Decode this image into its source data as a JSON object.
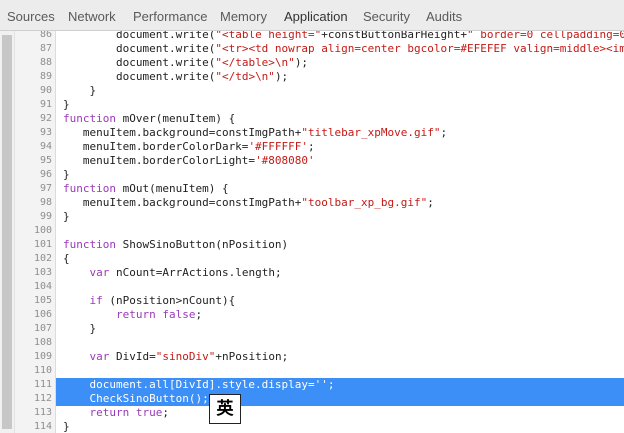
{
  "tabs": [
    {
      "label": "Sources",
      "active": false
    },
    {
      "label": "Network",
      "active": false
    },
    {
      "label": "Performance",
      "active": false
    },
    {
      "label": "Memory",
      "active": false
    },
    {
      "label": "Application",
      "active": true
    },
    {
      "label": "Security",
      "active": false
    },
    {
      "label": "Audits",
      "active": false
    }
  ],
  "colors": {
    "keyword": "#9a3bb8",
    "string": "#c41a16",
    "selection": "#3b8ff6",
    "line_number": "#8e8e8e"
  },
  "code_lines": [
    {
      "n": "86",
      "text": "        document.write(\"<table height=\"+constButtonBarHeight+\" border=0 cellpadding=0"
    },
    {
      "n": "87",
      "text": "        document.write(\"<tr><td nowrap align=center bgcolor=#EFEFEF valign=middle><im"
    },
    {
      "n": "88",
      "text": "        document.write(\"</table>\\n\");"
    },
    {
      "n": "89",
      "text": "        document.write(\"</td>\\n\");"
    },
    {
      "n": "90",
      "text": "    }"
    },
    {
      "n": "91",
      "text": "}"
    },
    {
      "n": "92",
      "text": "function mOver(menuItem) {"
    },
    {
      "n": "93",
      "text": "   menuItem.background=constImgPath+\"titlebar_xpMove.gif\";"
    },
    {
      "n": "94",
      "text": "   menuItem.borderColorDark='#FFFFFF';"
    },
    {
      "n": "95",
      "text": "   menuItem.borderColorLight='#808080'"
    },
    {
      "n": "96",
      "text": "}"
    },
    {
      "n": "97",
      "text": "function mOut(menuItem) {"
    },
    {
      "n": "98",
      "text": "   menuItem.background=constImgPath+\"toolbar_xp_bg.gif\";"
    },
    {
      "n": "99",
      "text": "}"
    },
    {
      "n": "100",
      "text": ""
    },
    {
      "n": "101",
      "text": "function ShowSinoButton(nPosition)"
    },
    {
      "n": "102",
      "text": "{"
    },
    {
      "n": "103",
      "text": "    var nCount=ArrActions.length;"
    },
    {
      "n": "104",
      "text": ""
    },
    {
      "n": "105",
      "text": "    if (nPosition>nCount){"
    },
    {
      "n": "106",
      "text": "        return false;"
    },
    {
      "n": "107",
      "text": "    }"
    },
    {
      "n": "108",
      "text": ""
    },
    {
      "n": "109",
      "text": "    var DivId=\"sinoDiv\"+nPosition;"
    },
    {
      "n": "110",
      "text": ""
    },
    {
      "n": "111",
      "text": "    document.all[DivId].style.display='';",
      "selected": true
    },
    {
      "n": "112",
      "text": "    CheckSinoButton();",
      "selected": true
    },
    {
      "n": "113",
      "text": "    return true;"
    },
    {
      "n": "114",
      "text": "}"
    }
  ],
  "ime_indicator": "英"
}
